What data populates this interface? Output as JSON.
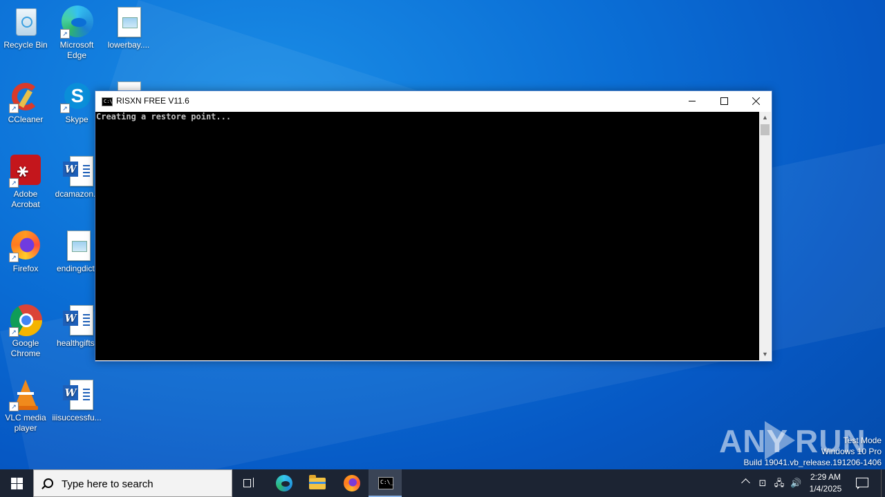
{
  "desktop": {
    "icons": [
      {
        "label": "Recycle Bin",
        "icon": "recycle-bin-icon"
      },
      {
        "label": "Microsoft Edge",
        "icon": "edge-icon"
      },
      {
        "label": "lowerbay....",
        "icon": "image-file-icon"
      },
      {
        "label": "CCleaner",
        "icon": "ccleaner-icon"
      },
      {
        "label": "Skype",
        "icon": "skype-icon"
      },
      {
        "label": "Adobe Acrobat",
        "icon": "acrobat-icon"
      },
      {
        "label": "dcamazon.r",
        "icon": "word-doc-icon"
      },
      {
        "label": "Firefox",
        "icon": "firefox-icon"
      },
      {
        "label": "endingdict.",
        "icon": "image-file-icon"
      },
      {
        "label": "Google Chrome",
        "icon": "chrome-icon"
      },
      {
        "label": "healthgifts.",
        "icon": "word-doc-icon"
      },
      {
        "label": "VLC media player",
        "icon": "vlc-icon"
      },
      {
        "label": "iiisuccessfu...",
        "icon": "word-doc-icon"
      }
    ]
  },
  "console_window": {
    "title": "RISXN FREE V11.6",
    "output": "Creating a restore point...",
    "buttons": {
      "minimize": "minimize-icon",
      "maximize": "maximize-icon",
      "close": "close-icon"
    }
  },
  "watermark": {
    "left": "ANY",
    "right": "RUN"
  },
  "system_info": {
    "line1": "Test Mode",
    "line2": "Windows 10 Pro",
    "line3": "Build 19041.vb_release.191206-1406"
  },
  "taskbar": {
    "search_placeholder": "Type here to search",
    "pinned": [
      "task-view-icon",
      "edge-icon",
      "file-explorer-icon",
      "firefox-icon",
      "cmd-icon"
    ],
    "clock_time": "2:29 AM",
    "clock_date": "1/4/2025"
  },
  "colors": {
    "desktop_bg": "#0b6fd6",
    "taskbar_bg": "#1c2433",
    "console_bg": "#000000",
    "console_text": "#c0c0c0"
  }
}
